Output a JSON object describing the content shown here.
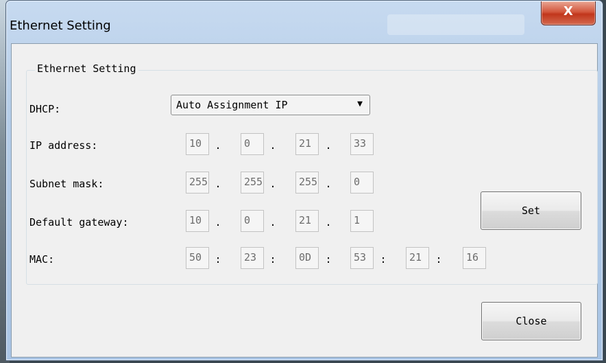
{
  "window": {
    "title": "Ethernet Setting",
    "close_glyph": "X"
  },
  "group": {
    "title": "Ethernet Setting"
  },
  "labels": {
    "dhcp": "DHCP:",
    "ip": "IP address:",
    "subnet": "Subnet mask:",
    "gateway": "Default gateway:",
    "mac": "MAC:"
  },
  "dhcp_select": {
    "value": "Auto Assignment IP",
    "arrow_icon": "▼"
  },
  "ip_address": [
    "10",
    "0",
    "21",
    "33"
  ],
  "subnet_mask": [
    "255",
    "255",
    "255",
    "0"
  ],
  "default_gateway": [
    "10",
    "0",
    "21",
    "1"
  ],
  "mac_address": [
    "50",
    "23",
    "0D",
    "53",
    "21",
    "16"
  ],
  "separators": {
    "ip": ".",
    "mac": ":"
  },
  "buttons": {
    "set": "Set",
    "close": "Close"
  }
}
